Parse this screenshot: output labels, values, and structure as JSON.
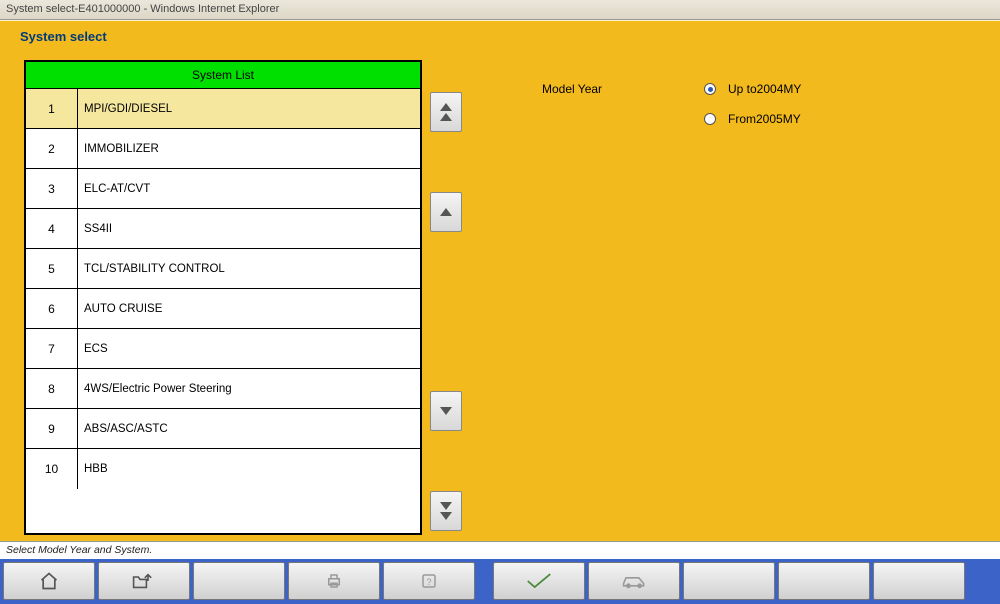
{
  "window_title": "System select-E401000000 - Windows Internet Explorer",
  "page_title": "System select",
  "system_list": {
    "header": "System List",
    "rows": [
      {
        "num": "1",
        "label": "MPI/GDI/DIESEL",
        "selected": true
      },
      {
        "num": "2",
        "label": "IMMOBILIZER"
      },
      {
        "num": "3",
        "label": "ELC-AT/CVT"
      },
      {
        "num": "4",
        "label": "SS4II"
      },
      {
        "num": "5",
        "label": "TCL/STABILITY CONTROL"
      },
      {
        "num": "6",
        "label": "AUTO CRUISE"
      },
      {
        "num": "7",
        "label": "ECS"
      },
      {
        "num": "8",
        "label": "4WS/Electric Power Steering"
      },
      {
        "num": "9",
        "label": "ABS/ASC/ASTC"
      },
      {
        "num": "10",
        "label": "HBB"
      }
    ]
  },
  "model_year": {
    "label": "Model Year",
    "options": [
      {
        "value": "Up to2004MY",
        "checked": true
      },
      {
        "value": "From2005MY",
        "checked": false
      }
    ]
  },
  "status_text": "Select Model Year and System."
}
